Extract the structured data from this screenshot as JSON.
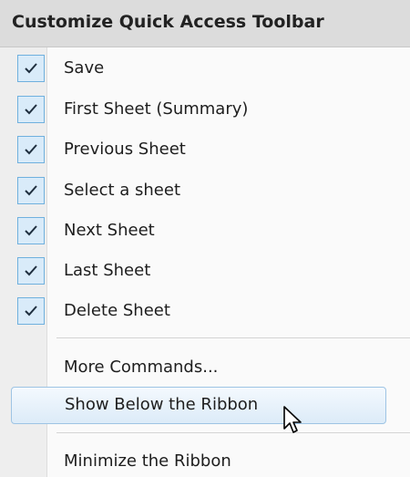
{
  "menu": {
    "title": "Customize Quick Access Toolbar",
    "checked_items": [
      {
        "label": "Save",
        "checked": true
      },
      {
        "label": "First Sheet (Summary)",
        "checked": true
      },
      {
        "label": "Previous Sheet",
        "checked": true
      },
      {
        "label": "Select a sheet",
        "checked": true
      },
      {
        "label": "Next Sheet",
        "checked": true
      },
      {
        "label": "Last Sheet",
        "checked": true
      },
      {
        "label": "Delete Sheet",
        "checked": true
      }
    ],
    "more_commands_label": "More Commands...",
    "show_below_label": "Show Below the Ribbon",
    "minimize_label": "Minimize the Ribbon"
  },
  "icons": {
    "check": "check-icon",
    "cursor": "mouse-pointer-icon"
  },
  "colors": {
    "header_bg": "#dcdcdc",
    "checkbox_border": "#6fb0de",
    "checkbox_fill": "#d9ebf9",
    "highlight_border": "#9ec4e4"
  }
}
